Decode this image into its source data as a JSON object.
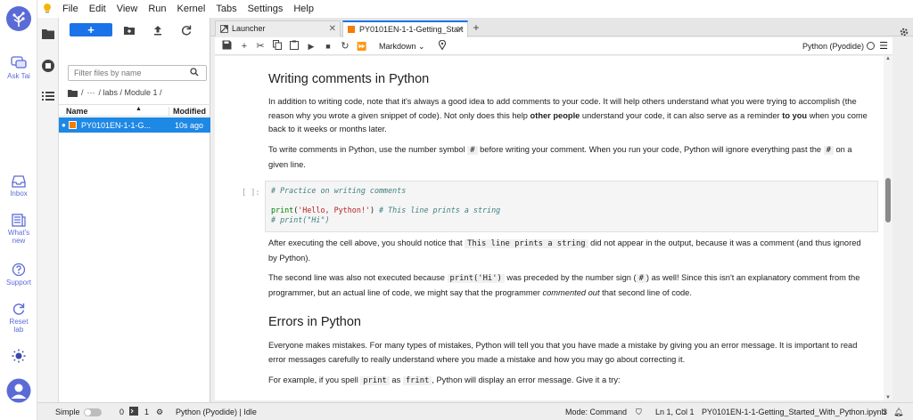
{
  "menubar": {
    "items": [
      "File",
      "Edit",
      "View",
      "Run",
      "Kernel",
      "Tabs",
      "Settings",
      "Help"
    ]
  },
  "rail": {
    "ask": "Ask Tai",
    "inbox": "Inbox",
    "whats_new": "What's new",
    "support": "Support",
    "reset": "Reset lab"
  },
  "filebrowser": {
    "new_label": "+",
    "filter_placeholder": "Filter files by name",
    "breadcrumb": [
      "/",
      "···",
      "/ labs / Module 1 /"
    ],
    "col_name": "Name",
    "col_modified": "Modified",
    "files": [
      {
        "name": "PY0101EN-1-1-G...",
        "modified": "10s ago"
      }
    ]
  },
  "tabs": [
    {
      "label": "Launcher",
      "active": false
    },
    {
      "label": "PY0101EN-1-1-Getting_Start",
      "active": true
    }
  ],
  "toolbar": {
    "cell_type": "Markdown",
    "kernel": "Python (Pyodide)"
  },
  "notebook": {
    "h_comments": "Writing comments in Python",
    "p1_a": "In addition to writing code, note that it's always a good idea to add comments to your code. It will help others understand what you were trying to accomplish (the reason why you wrote a given snippet of code). Not only does this help ",
    "p1_b": "other people",
    "p1_c": " understand your code, it can also serve as a reminder ",
    "p1_d": "to you",
    "p1_e": " when you come back to it weeks or months later.",
    "p2_a": "To write comments in Python, use the number symbol ",
    "p2_code1": "#",
    "p2_b": " before writing your comment. When you run your code, Python will ignore everything past the ",
    "p2_code2": "#",
    "p2_c": " on a given line.",
    "prompt": "[ ]:",
    "code_line1": "# Practice on writing comments",
    "code_line2_fn": "print",
    "code_line2_open": "(",
    "code_line2_str": "'Hello, Python!'",
    "code_line2_close": ") ",
    "code_line2_cm": "# This line prints a string",
    "code_line3": "# print(\"Hi\")",
    "p3_a": "After executing the cell above, you should notice that ",
    "p3_code": "This line prints a string",
    "p3_b": " did not appear in the output, because it was a comment (and thus ignored by Python).",
    "p4_a": "The second line was also not executed because ",
    "p4_code1": "print('Hi')",
    "p4_b": " was preceded by the number sign (",
    "p4_code2": "#",
    "p4_c": ") as well! Since this isn't an explanatory comment from the programmer, but an actual line of code, we might say that the programmer ",
    "p4_d": "commented out",
    "p4_e": " that second line of code.",
    "h_errors": "Errors in Python",
    "p5": "Everyone makes mistakes. For many types of mistakes, Python will tell you that you have made a mistake by giving you an error message. It is important to read error messages carefully to really understand where you made a mistake and how you may go about correcting it.",
    "p6_a": "For example, if you spell ",
    "p6_code1": "print",
    "p6_b": " as ",
    "p6_code2": "frint",
    "p6_c": ", Python will display an error message. Give it a try:"
  },
  "statusbar": {
    "simple": "Simple",
    "count1": "0",
    "count2": "1",
    "kernel_status": "Python (Pyodide) | Idle",
    "mode": "Mode: Command",
    "position": "Ln 1, Col 1",
    "filename": "PY0101EN-1-1-Getting_Started_With_Python.ipynb",
    "notifications": "3"
  },
  "colors": {
    "accent": "#1a73e8",
    "selected_row": "#1e88e5",
    "rail_icon": "#5b6bd6"
  }
}
